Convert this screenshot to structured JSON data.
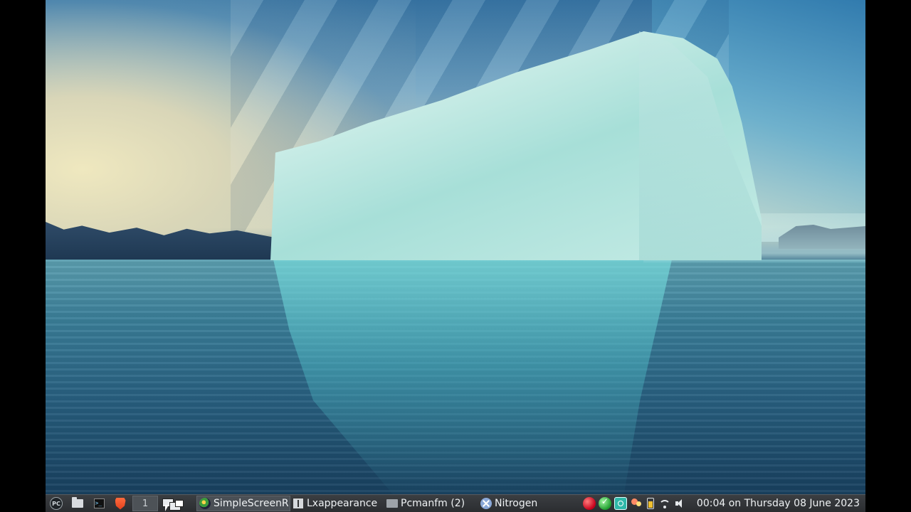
{
  "wallpaper": {
    "description_icon": "iceberg-wallpaper"
  },
  "taskbar": {
    "menu": {
      "icon": "pc-menu-icon",
      "label": "PC"
    },
    "launchers": [
      {
        "name": "file-manager",
        "icon": "folder-icon"
      },
      {
        "name": "terminal",
        "icon": "terminal-icon"
      },
      {
        "name": "browser",
        "icon": "brave-icon"
      }
    ],
    "workspace": {
      "number": "1"
    },
    "tasks": [
      {
        "label": "SimpleScreenR",
        "icon": "simplescreenrecorder-icon",
        "active": true
      },
      {
        "label": "Lxappearance",
        "icon": "lxappearance-icon",
        "active": false
      },
      {
        "label": "Pcmanfm (2)",
        "icon": "folder-icon",
        "active": false
      },
      {
        "label": "Nitrogen",
        "icon": "nitrogen-icon",
        "active": false
      }
    ],
    "tray_icons": [
      "red-circle-icon",
      "green-check-icon",
      "teal-app-icon",
      "bulb-icon",
      "battery-icon",
      "wifi-icon",
      "volume-icon"
    ],
    "clock": "00:04 on Thursday 08 June 2023"
  },
  "colors": {
    "taskbar_bg": "#2b2d30",
    "taskbar_text": "#eef1f3",
    "active_task_bg": "#4a4f55"
  }
}
